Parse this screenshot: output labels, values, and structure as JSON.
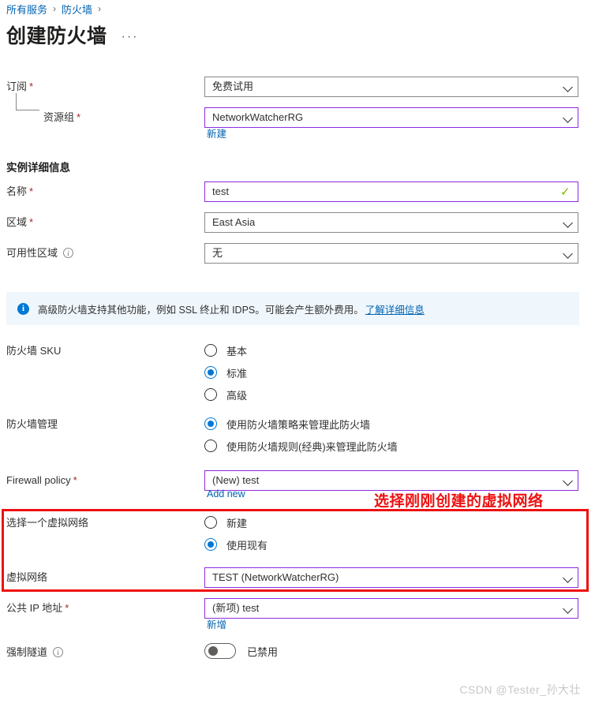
{
  "breadcrumb": {
    "items": [
      {
        "label": "所有服务"
      },
      {
        "label": "防火墙"
      }
    ],
    "separator": "›"
  },
  "header": {
    "title": "创建防火墙",
    "ellipsis": "···"
  },
  "project_details": {
    "subscription": {
      "label": "订阅",
      "required": "*",
      "value": "免费试用"
    },
    "resource_group": {
      "label": "资源组",
      "required": "*",
      "value": "NetworkWatcherRG",
      "sublink": "新建"
    }
  },
  "instance_details": {
    "heading": "实例详细信息",
    "name": {
      "label": "名称",
      "required": "*",
      "value": "test",
      "valid_mark": "✓"
    },
    "region": {
      "label": "区域",
      "required": "*",
      "value": "East Asia"
    },
    "availability_zone": {
      "label": "可用性区域",
      "info": "i",
      "value": "无"
    }
  },
  "banner": {
    "icon": "i",
    "text": "高级防火墙支持其他功能，例如 SSL 终止和 IDPS。可能会产生额外费用。",
    "link": "了解详细信息"
  },
  "firewall_sku": {
    "label": "防火墙 SKU",
    "options": [
      {
        "label": "基本",
        "selected": false
      },
      {
        "label": "标准",
        "selected": true
      },
      {
        "label": "高级",
        "selected": false
      }
    ]
  },
  "firewall_management": {
    "label": "防火墙管理",
    "options": [
      {
        "label": "使用防火墙策略来管理此防火墙",
        "selected": true
      },
      {
        "label": "使用防火墙规则(经典)来管理此防火墙",
        "selected": false
      }
    ]
  },
  "firewall_policy": {
    "label": "Firewall policy",
    "required": "*",
    "value": "(New) test",
    "sublink": "Add new"
  },
  "choose_vnet": {
    "label": "选择一个虚拟网络",
    "options": [
      {
        "label": "新建",
        "selected": false
      },
      {
        "label": "使用现有",
        "selected": true
      }
    ]
  },
  "virtual_network": {
    "label": "虚拟网络",
    "value": "TEST (NetworkWatcherRG)"
  },
  "public_ip": {
    "label": "公共 IP 地址",
    "required": "*",
    "value": "(新项) test",
    "sublink": "新增"
  },
  "forced_tunneling": {
    "label": "强制隧道",
    "info": "i",
    "enabled": false,
    "state_label": "已禁用"
  },
  "annotation": {
    "text": "选择刚刚创建的虚拟网络",
    "color": "#ee1111"
  },
  "watermark": {
    "text": "CSDN @Tester_孙大壮"
  }
}
